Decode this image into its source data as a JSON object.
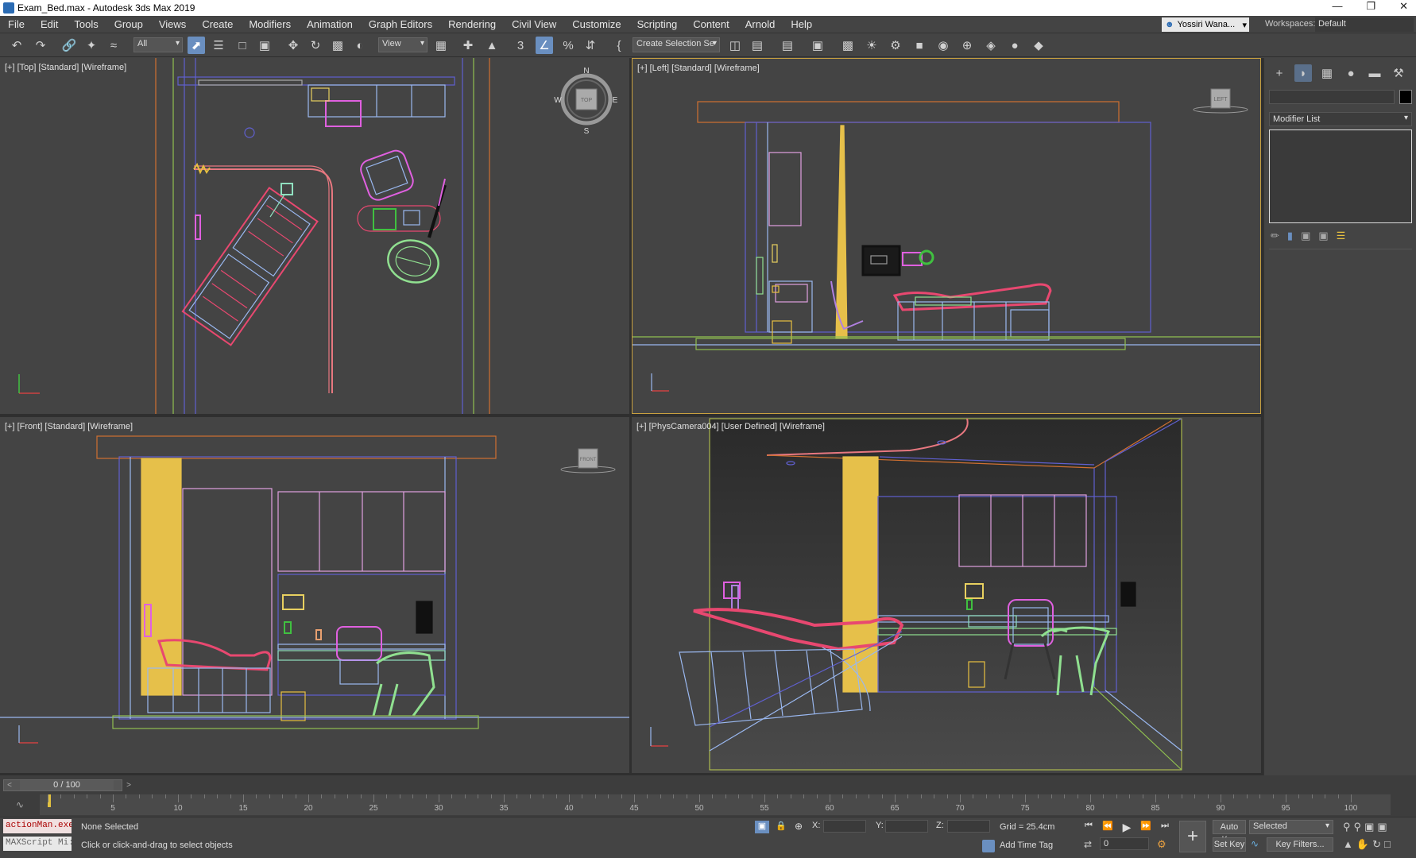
{
  "window": {
    "title": "Exam_Bed.max - Autodesk 3ds Max 2019",
    "controls": [
      "—",
      "❐",
      "✕"
    ]
  },
  "menu": {
    "items": [
      "File",
      "Edit",
      "Tools",
      "Group",
      "Views",
      "Create",
      "Modifiers",
      "Animation",
      "Graph Editors",
      "Rendering",
      "Civil View",
      "Customize",
      "Scripting",
      "Content",
      "Arnold",
      "Help"
    ],
    "user": "Yossiri Wana...",
    "workspaces_label": "Workspaces:",
    "workspaces_value": "Default"
  },
  "toolbar": {
    "filter": "All",
    "ref_coord": "View",
    "selection_set": "Create Selection Se"
  },
  "viewports": {
    "top": {
      "label": "[+] [Top] [Standard] [Wireframe]",
      "compass": [
        "N",
        "E",
        "S",
        "W"
      ],
      "cube": "TOP"
    },
    "left": {
      "label": "[+] [Left] [Standard] [Wireframe]",
      "cube": "LEFT"
    },
    "front": {
      "label": "[+] [Front] [Standard] [Wireframe]",
      "cube": "FRONT"
    },
    "camera": {
      "label": "[+] [PhysCamera004] [User Defined] [Wireframe]"
    }
  },
  "command_panel": {
    "modifier_list": "Modifier List"
  },
  "timeline": {
    "position": "0 / 100",
    "ticks": [
      5,
      10,
      15,
      20,
      25,
      30,
      35,
      40,
      45,
      50,
      55,
      60,
      65,
      70,
      75,
      80,
      85,
      90,
      95,
      100
    ]
  },
  "status": {
    "maxscript_1": "actionMan.exe",
    "maxscript_2": "MAXScript Mi:",
    "selection": "None Selected",
    "prompt": "Click or click-and-drag to select objects",
    "x_label": "X:",
    "y_label": "Y:",
    "z_label": "Z:",
    "grid": "Grid = 25.4cm",
    "time_tag": "Add Time Tag",
    "auto_key": "Auto Key",
    "set_key": "Set Key",
    "key_mode": "Selected",
    "key_filters": "Key Filters...",
    "current_frame": "0"
  },
  "colors": {
    "viewport_bg": "#444444",
    "active_border": "#c8a040",
    "pillar_yellow": "#e6c04a",
    "bed_red": "#e84870",
    "bed_blue": "#9ab8f0",
    "chair_green": "#90e090",
    "wall_blue": "#6060d0",
    "cabinet_pink": "#e0a0e0"
  }
}
